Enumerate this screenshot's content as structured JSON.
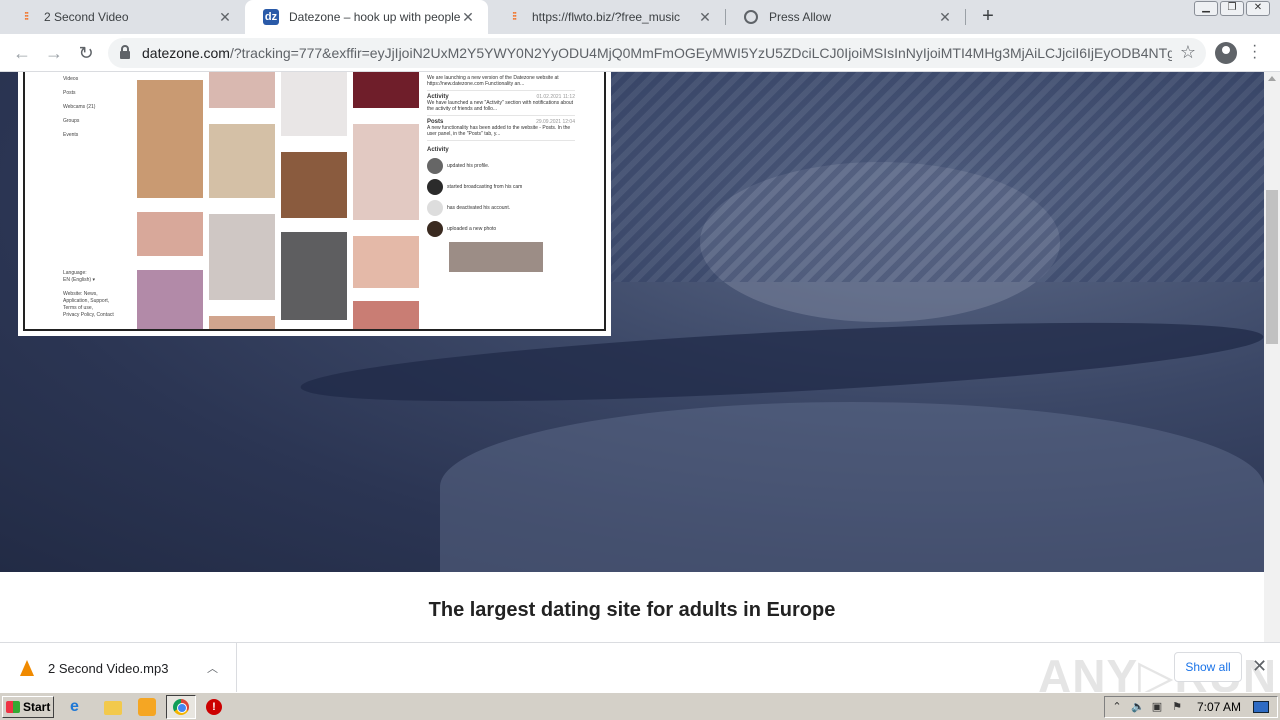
{
  "browser": {
    "tabs": [
      {
        "title": "2 Second Video",
        "icon": "audio-wave-icon",
        "active": false
      },
      {
        "title": "Datezone – hook up with people!",
        "icon": "datezone-icon",
        "active": true
      },
      {
        "title": "https://flwto.biz/?free_music",
        "icon": "audio-wave-icon",
        "active": false
      },
      {
        "title": "Press Allow",
        "icon": "globe-icon",
        "active": false
      }
    ],
    "url_host": "datezone.com",
    "url_rest": "/?tracking=777&exffir=eyJjIjoiN2UxM2Y5YWY0N2YyODU4MjQ0MmFmOGEyMWI5YzU5ZDciLCJ0IjoiMSIsInNyIjoiMTI4MHg3MjAiLCJjciI6IjEyODB4NTg3Ii..."
  },
  "preview": {
    "sidebar": [
      "Videos",
      "Posts",
      "Webcams (21)",
      "Groups",
      "Events"
    ],
    "footer": [
      "Language:",
      "EN (English) ▾",
      "Website: News,",
      "Application, Support,",
      "Terms of use,",
      "Privacy Policy, Contact"
    ],
    "news": [
      {
        "title": "",
        "date": "",
        "text": "We are launching a new version of the Datezone website at https://new.datezone.com Functionality an..."
      },
      {
        "title": "Activity",
        "date": "01.02.2021 11:12",
        "text": "We have launched a new \"Activity\" section with notifications about the activity of friends and follo..."
      },
      {
        "title": "Posts",
        "date": "29.09.2021 12:04",
        "text": "A new functionality has been added to the website - Posts. In the user panel, in the \"Posts\" tab, y..."
      }
    ],
    "activity_title": "Activity",
    "activity": [
      {
        "action": "updated his profile."
      },
      {
        "action": "started broadcasting from his cam"
      },
      {
        "action": "has deactivated his account."
      },
      {
        "action": "uploaded a new photo"
      }
    ]
  },
  "tagline": "The largest dating site for adults in Europe",
  "downloads": {
    "file": "2 Second Video.mp3",
    "show_all": "Show all"
  },
  "watermark": "ANY▷RUN",
  "taskbar": {
    "start": "Start",
    "clock": "7:07 AM"
  }
}
